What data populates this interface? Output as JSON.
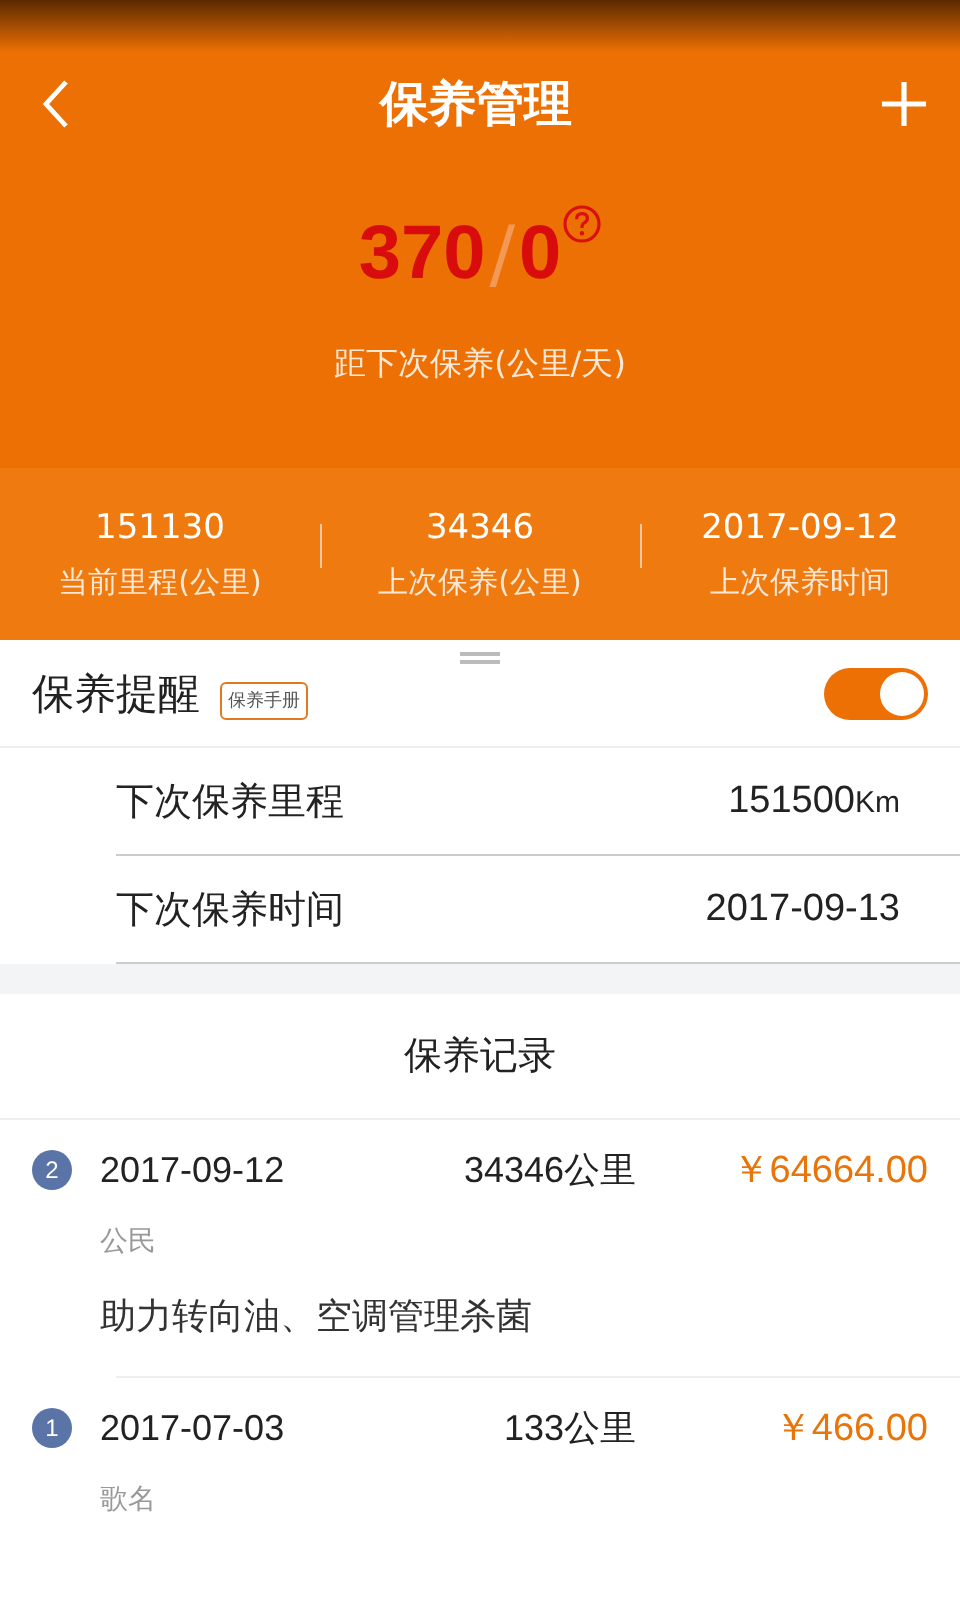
{
  "header": {
    "title": "保养管理",
    "remaining": {
      "km": "370",
      "separator": "/",
      "days": "0"
    },
    "remaining_label": "距下次保养(公里/天)"
  },
  "stats": [
    {
      "value": "151130",
      "label": "当前里程(公里)"
    },
    {
      "value": "34346",
      "label": "上次保养(公里)"
    },
    {
      "value": "2017-09-12",
      "label": "上次保养时间"
    }
  ],
  "reminder": {
    "label": "保养提醒",
    "tag": "保养手册",
    "on": true,
    "rows": [
      {
        "label": "下次保养里程",
        "value": "151500",
        "unit": "Km"
      },
      {
        "label": "下次保养时间",
        "value": "2017-09-13"
      }
    ]
  },
  "records": {
    "title": "保养记录",
    "items": [
      {
        "index": "2",
        "date": "2017-09-12",
        "mileage": "34346公里",
        "cost": "￥64664.00",
        "shop": "公民",
        "items": "助力转向油、空调管理杀菌"
      },
      {
        "index": "1",
        "date": "2017-07-03",
        "mileage": "133公里",
        "cost": "￥466.00",
        "shop": "歌名"
      }
    ]
  }
}
